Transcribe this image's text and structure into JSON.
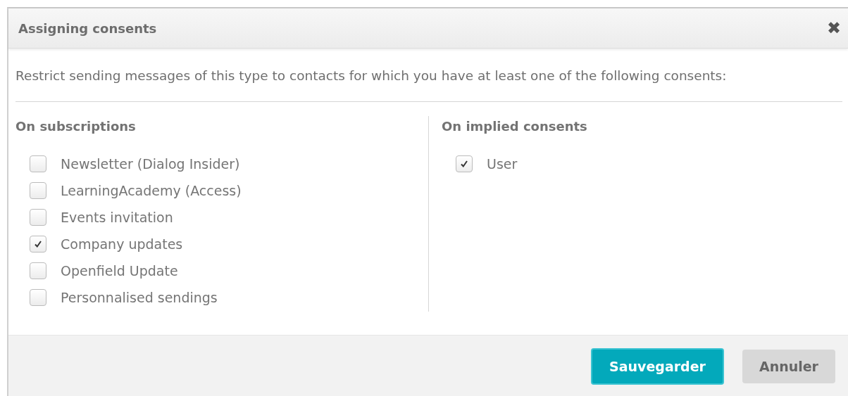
{
  "dialog": {
    "title": "Assigning consents",
    "close_icon": "✖",
    "intro": "Restrict sending messages of this type to contacts for which you have at least one of the following consents:",
    "groups": [
      {
        "heading": "On subscriptions",
        "items": [
          {
            "label": "Newsletter (Dialog Insider)",
            "checked": false
          },
          {
            "label": "LearningAcademy (Access)",
            "checked": false
          },
          {
            "label": "Events invitation",
            "checked": false
          },
          {
            "label": "Company updates",
            "checked": true
          },
          {
            "label": "Openfield Update",
            "checked": false
          },
          {
            "label": "Personnalised sendings",
            "checked": false
          }
        ]
      },
      {
        "heading": "On implied consents",
        "items": [
          {
            "label": "User",
            "checked": true
          }
        ]
      }
    ],
    "buttons": [
      {
        "label": "Sauvegarder",
        "kind": "primary"
      },
      {
        "label": "Annuler",
        "kind": "secondary"
      }
    ]
  }
}
